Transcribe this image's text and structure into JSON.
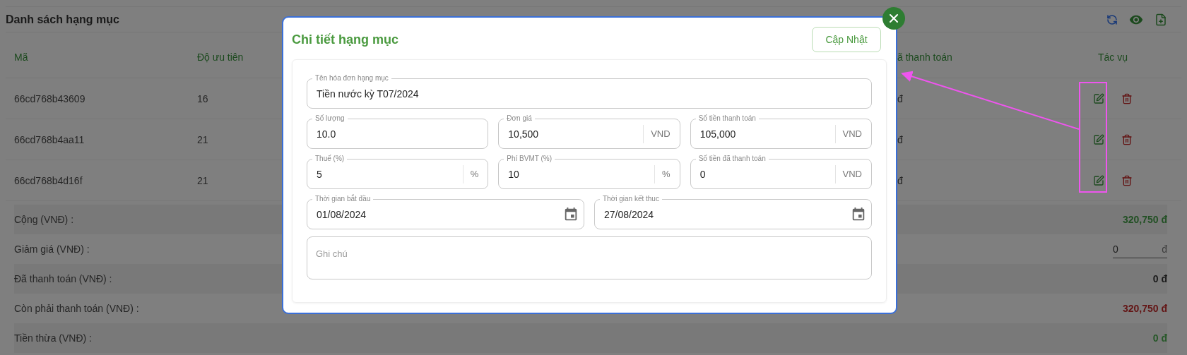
{
  "page": {
    "title": "Danh sách hạng mục"
  },
  "table": {
    "columns": [
      "Mã",
      "Độ ưu tiên",
      "ã thanh toán",
      "Tác vụ"
    ],
    "rows": [
      {
        "code": "66cd768b43609",
        "priority": "16",
        "paid": "đ"
      },
      {
        "code": "66cd768b4aa11",
        "priority": "21",
        "paid": "đ"
      },
      {
        "code": "66cd768b4d16f",
        "priority": "21",
        "paid": "đ"
      }
    ]
  },
  "summary": [
    {
      "kind": "text",
      "label": "Cộng (VNĐ) :",
      "value": "320,750 đ",
      "color": "#225024"
    },
    {
      "kind": "input",
      "label": "Giảm giá (VNĐ) :",
      "value": "0",
      "unit": "đ"
    },
    {
      "kind": "text",
      "label": "Đã thanh toán (VNĐ) :",
      "value": "0 đ",
      "color": "#1a1a1a"
    },
    {
      "kind": "text",
      "label": "Còn phải thanh toán (VNĐ) :",
      "value": "320,750 đ",
      "color": "#631414"
    },
    {
      "kind": "text",
      "label": "Tiền thừa (VNĐ) :",
      "value": "0 đ",
      "color": "#265828"
    }
  ],
  "modal": {
    "title": "Chi tiết hạng mục",
    "update_button": "Cập Nhật",
    "field_rows": [
      [
        {
          "kind": "text",
          "label": "Tên hóa đơn hạng mục",
          "value": "Tiền nước  kỳ T07/2024"
        }
      ],
      [
        {
          "kind": "text",
          "label": "Số lượng",
          "value": "10.0"
        },
        {
          "kind": "text",
          "label": "Đơn giá",
          "value": "10,500",
          "suffix": "VND"
        },
        {
          "kind": "text",
          "label": "Số tiền thanh toán",
          "value": "105,000",
          "suffix": "VND"
        }
      ],
      [
        {
          "kind": "text",
          "label": "Thuế (%)",
          "value": "5",
          "suffix": "%"
        },
        {
          "kind": "text",
          "label": "Phí BVMT (%)",
          "value": "10",
          "suffix": "%"
        },
        {
          "kind": "text",
          "label": "Số tiền đã thanh toán",
          "value": "0",
          "suffix": "VND"
        }
      ],
      [
        {
          "kind": "date",
          "label": "Thời gian bắt đầu",
          "value": "01/08/2024"
        },
        {
          "kind": "date",
          "label": "Thời gian kết thuc",
          "value": "27/08/2024"
        }
      ],
      [
        {
          "kind": "textarea",
          "placeholder": "Ghi chú"
        }
      ]
    ]
  }
}
